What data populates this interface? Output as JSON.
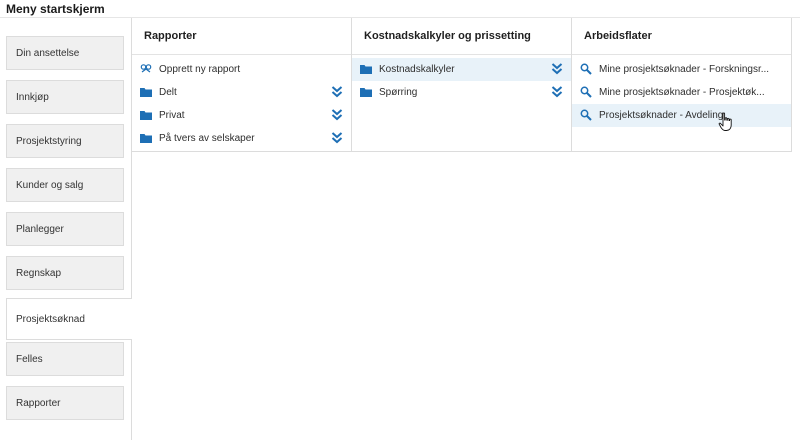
{
  "page": {
    "title": "Meny startskjerm"
  },
  "colors": {
    "accent": "#1e6fb5",
    "selected_row": "#e8f2f9",
    "tab_bg": "#f0f0f0"
  },
  "sidebar": {
    "items": [
      {
        "label": "Din ansettelse",
        "active": false
      },
      {
        "label": "Innkjøp",
        "active": false
      },
      {
        "label": "Prosjektstyring",
        "active": false
      },
      {
        "label": "Kunder og salg",
        "active": false
      },
      {
        "label": "Planlegger",
        "active": false
      },
      {
        "label": "Regnskap",
        "active": false
      },
      {
        "label": "Prosjektsøknad",
        "active": true
      },
      {
        "label": "Felles",
        "active": false
      },
      {
        "label": "Rapporter",
        "active": false
      }
    ]
  },
  "columns": [
    {
      "header": "Rapporter",
      "rows": [
        {
          "label": "Opprett ny rapport",
          "icon": "new-report-icon",
          "expand": false
        },
        {
          "label": "Delt",
          "icon": "folder-icon",
          "expand": true
        },
        {
          "label": "Privat",
          "icon": "folder-icon",
          "expand": true
        },
        {
          "label": "På tvers av selskaper",
          "icon": "folder-icon",
          "expand": true
        }
      ]
    },
    {
      "header": "Kostnadskalkyler og prissetting",
      "rows": [
        {
          "label": "Kostnadskalkyler",
          "icon": "folder-icon",
          "expand": true,
          "selected": true
        },
        {
          "label": "Spørring",
          "icon": "folder-icon",
          "expand": true
        }
      ]
    },
    {
      "header": "Arbeidsflater",
      "rows": [
        {
          "label": "Mine prosjektsøknader - Forskningsr...",
          "icon": "search-icon"
        },
        {
          "label": "Mine prosjektsøknader - Prosjektøk...",
          "icon": "search-icon"
        },
        {
          "label": "Prosjektsøknader - Avdeling",
          "icon": "search-icon",
          "hovered": true
        }
      ]
    }
  ]
}
